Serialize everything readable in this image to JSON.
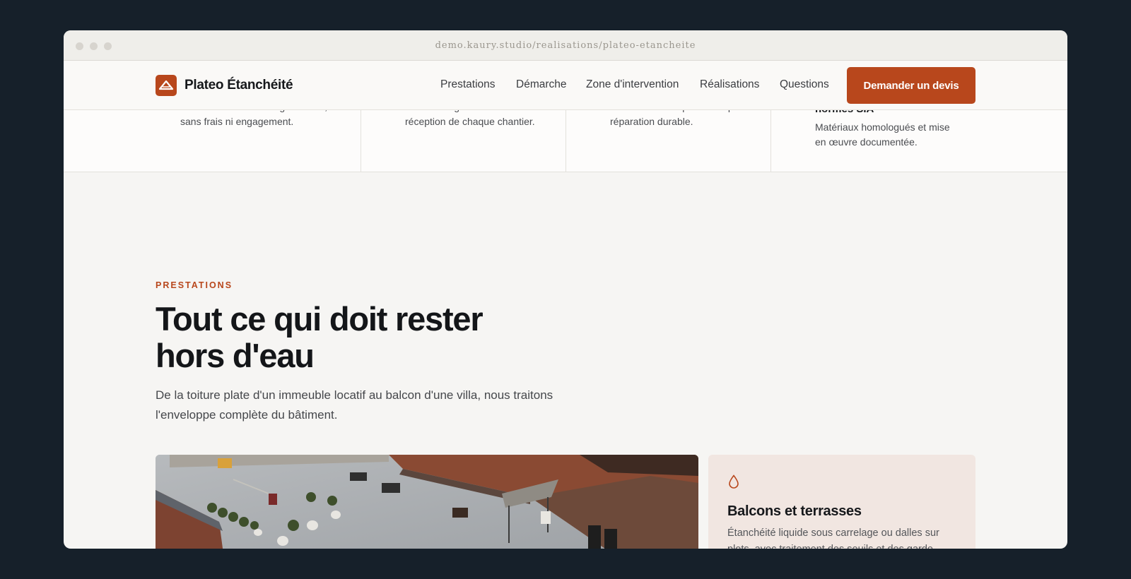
{
  "browser": {
    "url": "demo.kaury.studio/realisations/plateo-etancheite"
  },
  "header": {
    "brand_name": "Plateo Étanchéité",
    "logo_icon": "roof-triangle-icon",
    "nav": [
      "Prestations",
      "Démarche",
      "Zone d'intervention",
      "Réalisations",
      "Questions"
    ],
    "cta_label": "Demander un devis"
  },
  "features": [
    {
      "lines": [
        "Visite sur site et chiffrage détaillé,",
        "sans frais ni engagement."
      ]
    },
    {
      "lines": [
        "Contrat de garantie remis à la",
        "réception de chaque chantier."
      ]
    },
    {
      "lines": [
        "Mise hors d'eau provisoire puis",
        "réparation durable."
      ]
    },
    {
      "heading": "normes SIA",
      "lines": [
        "Matériaux homologués et mise",
        "en œuvre documentée."
      ]
    }
  ],
  "prestations": {
    "eyebrow": "PRESTATIONS",
    "title": "Tout ce qui doit rester hors d'eau",
    "lead": "De la toiture plate d'un immeuble locatif au balcon d'une villa, nous traitons l'enveloppe complète du bâtiment.",
    "photo_subject": "rooftop-terrace-photo",
    "card": {
      "icon": "water-drop-icon",
      "title": "Balcons et terrasses",
      "description": "Étanchéité liquide sous carrelage ou dalles sur plots, avec traitement des seuils et des garde-corps."
    }
  },
  "colors": {
    "accent": "#b8471c",
    "background": "#16202a",
    "card_tint": "#f1e6e1"
  }
}
